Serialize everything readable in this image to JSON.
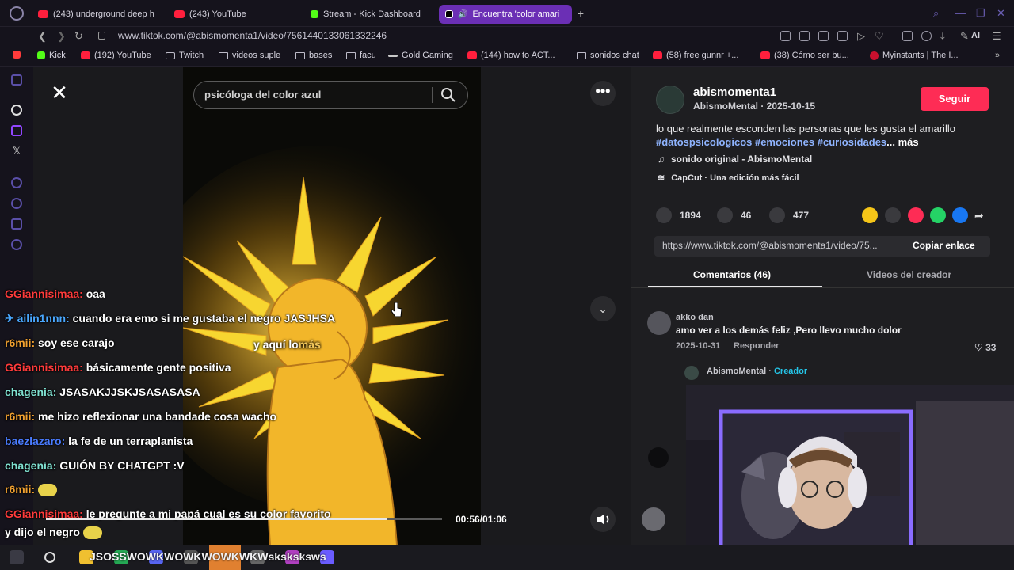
{
  "browser": {
    "tabs": [
      {
        "label": "(243) underground deep h",
        "color": "#ff1f3d"
      },
      {
        "label": "(243) YouTube",
        "color": "#ff1f3d"
      },
      {
        "label": "Stream - Kick Dashboard",
        "color": "#53fc18"
      },
      {
        "label": "Encuentra 'color amari",
        "color": "#ffffff",
        "active": true
      }
    ],
    "url": "www.tiktok.com/@abismomenta1/video/7561440133061332246",
    "ai_label": "AI",
    "bookmarks": [
      {
        "label": "Kick",
        "icon": "kick-icon"
      },
      {
        "label": "(192) YouTube",
        "icon": "youtube-icon"
      },
      {
        "label": "Twitch",
        "icon": "page-icon"
      },
      {
        "label": "videos suple",
        "icon": "folder-icon"
      },
      {
        "label": "bases",
        "icon": "folder-icon"
      },
      {
        "label": "facu",
        "icon": "folder-icon"
      },
      {
        "label": "Gold Gaming",
        "icon": "gold-icon"
      },
      {
        "label": "(144) how to ACT...",
        "icon": "youtube-icon"
      },
      {
        "label": "sonidos chat",
        "icon": "folder-icon"
      },
      {
        "label": "(58) free gunnr +...",
        "icon": "youtube-icon"
      },
      {
        "label": "(38) Cómo ser bu...",
        "icon": "youtube-icon"
      },
      {
        "label": "Myinstants | The I...",
        "icon": "myinstants-icon"
      }
    ]
  },
  "video": {
    "search_text": "psicóloga del color azul",
    "subtitle_main": "y aquí lo",
    "subtitle_dim": "más",
    "time": "00:56/01:06",
    "progress": 0.86
  },
  "chat": [
    {
      "user": "GGiannisimaa:",
      "color": "#ff3b3b",
      "text": "oaa"
    },
    {
      "user": "ailin1nnn:",
      "color": "#4aa8ff",
      "text": "cuando era emo si me gustaba el negro JASJHSA"
    },
    {
      "user": "r6mii:",
      "color": "#f0a030",
      "text": "soy ese carajo"
    },
    {
      "user": "GGiannisimaa:",
      "color": "#ff3b3b",
      "text": "básicamente gente positiva"
    },
    {
      "user": "chagenia:",
      "color": "#7fe0d0",
      "text": "JSASAKJJSKJSASASASA"
    },
    {
      "user": "r6mii:",
      "color": "#f0a030",
      "text": "me hizo reflexionar una bandade cosa wacho"
    },
    {
      "user": "baezlazaro:",
      "color": "#4a7cff",
      "text": "la fe de un terraplanista"
    },
    {
      "user": "chagenia:",
      "color": "#7fe0d0",
      "text": "GUIÓN BY CHATGPT :V"
    },
    {
      "user": "r6mii:",
      "color": "#f0a030",
      "text": ""
    },
    {
      "user": "GGiannisimaa:",
      "color": "#ff3b3b",
      "text": "le pregunte a mi papá cual es su color favorito"
    },
    {
      "user": "",
      "color": "#ffffff",
      "text": "y dijo el negro"
    }
  ],
  "post": {
    "author": "abismomenta1",
    "author_meta": "AbismoMental · 2025-10-15",
    "follow": "Seguir",
    "desc_text": "lo que realmente esconden las personas que les gusta el amarillo ",
    "tags": "#datospsicologicos #emociones #curiosidades",
    "desc_more": "... más",
    "music": "sonido original - AbismoMental",
    "capcut": "CapCut · Una edición más fácil",
    "likes": "1894",
    "comments": "46",
    "saves": "477",
    "link": "https://www.tiktok.com/@abismomenta1/video/75...",
    "copy_link": "Copiar enlace",
    "tab_comments": "Comentarios (46)",
    "tab_creator": "Videos del creador"
  },
  "comments": [
    {
      "user": "akko dan",
      "text": "amo ver a los demás feliz ,Pero llevo mucho dolor",
      "date": "2025-10-31",
      "reply": "Responder",
      "likes": "33"
    },
    {
      "user": "AbismoMental",
      "creator": "Creador"
    }
  ],
  "taskbar": {
    "overlay_text": "JSOSSWOWKWOWKWOWKWKWsksksksws"
  },
  "colors": {
    "accent": "#fe2c55",
    "tag": "#8fb4ff",
    "active_tab": "#6b2fb5"
  }
}
